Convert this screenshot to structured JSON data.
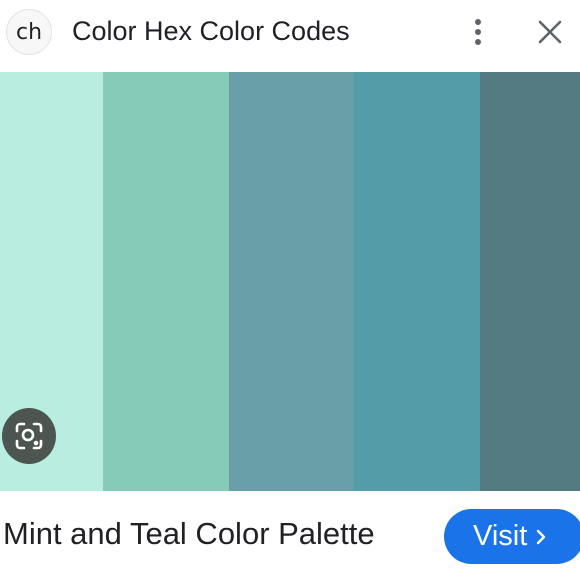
{
  "header": {
    "site_initials": "ch",
    "site_title": "Color Hex Color Codes",
    "more_icon": "more-vert-icon",
    "close_icon": "close-icon"
  },
  "palette": {
    "swatches": [
      {
        "color": "#b9ede0"
      },
      {
        "color": "#86cbb8"
      },
      {
        "color": "#699fa8"
      },
      {
        "color": "#549ca8"
      },
      {
        "color": "#557b82"
      }
    ]
  },
  "lens": {
    "icon": "lens-search-icon"
  },
  "result": {
    "title": "Mint and Teal Color Palette",
    "visit_label": "Visit",
    "visit_icon": "chevron-right-icon",
    "accent": "#1a73e8"
  }
}
